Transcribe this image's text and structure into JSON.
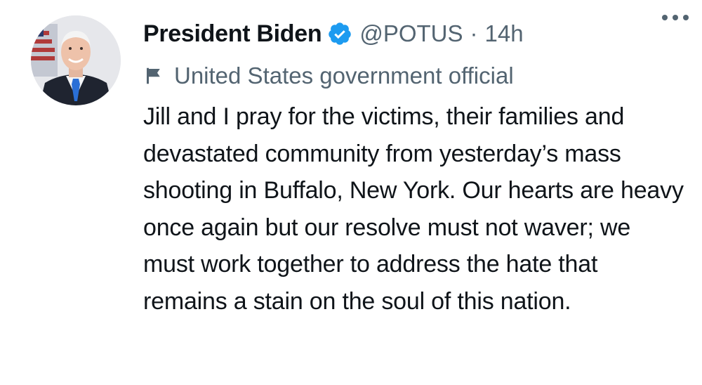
{
  "author": {
    "display_name": "President Biden",
    "handle": "@POTUS",
    "separator": "·",
    "time": "14h",
    "avatar_icon": "profile-photo"
  },
  "label": {
    "icon": "flag-icon",
    "text": "United States government official"
  },
  "tweet": {
    "text": "Jill and I pray for the victims, their families and devastated community from yesterday’s mass shooting in Buffalo, New York. Our hearts are heavy once again but our resolve must not waver; we must work together to address the hate that remains a stain on the soul of this nation."
  },
  "colors": {
    "primary_text": "#0f1419",
    "secondary_text": "#536471",
    "verified_blue": "#1d9bf0"
  }
}
